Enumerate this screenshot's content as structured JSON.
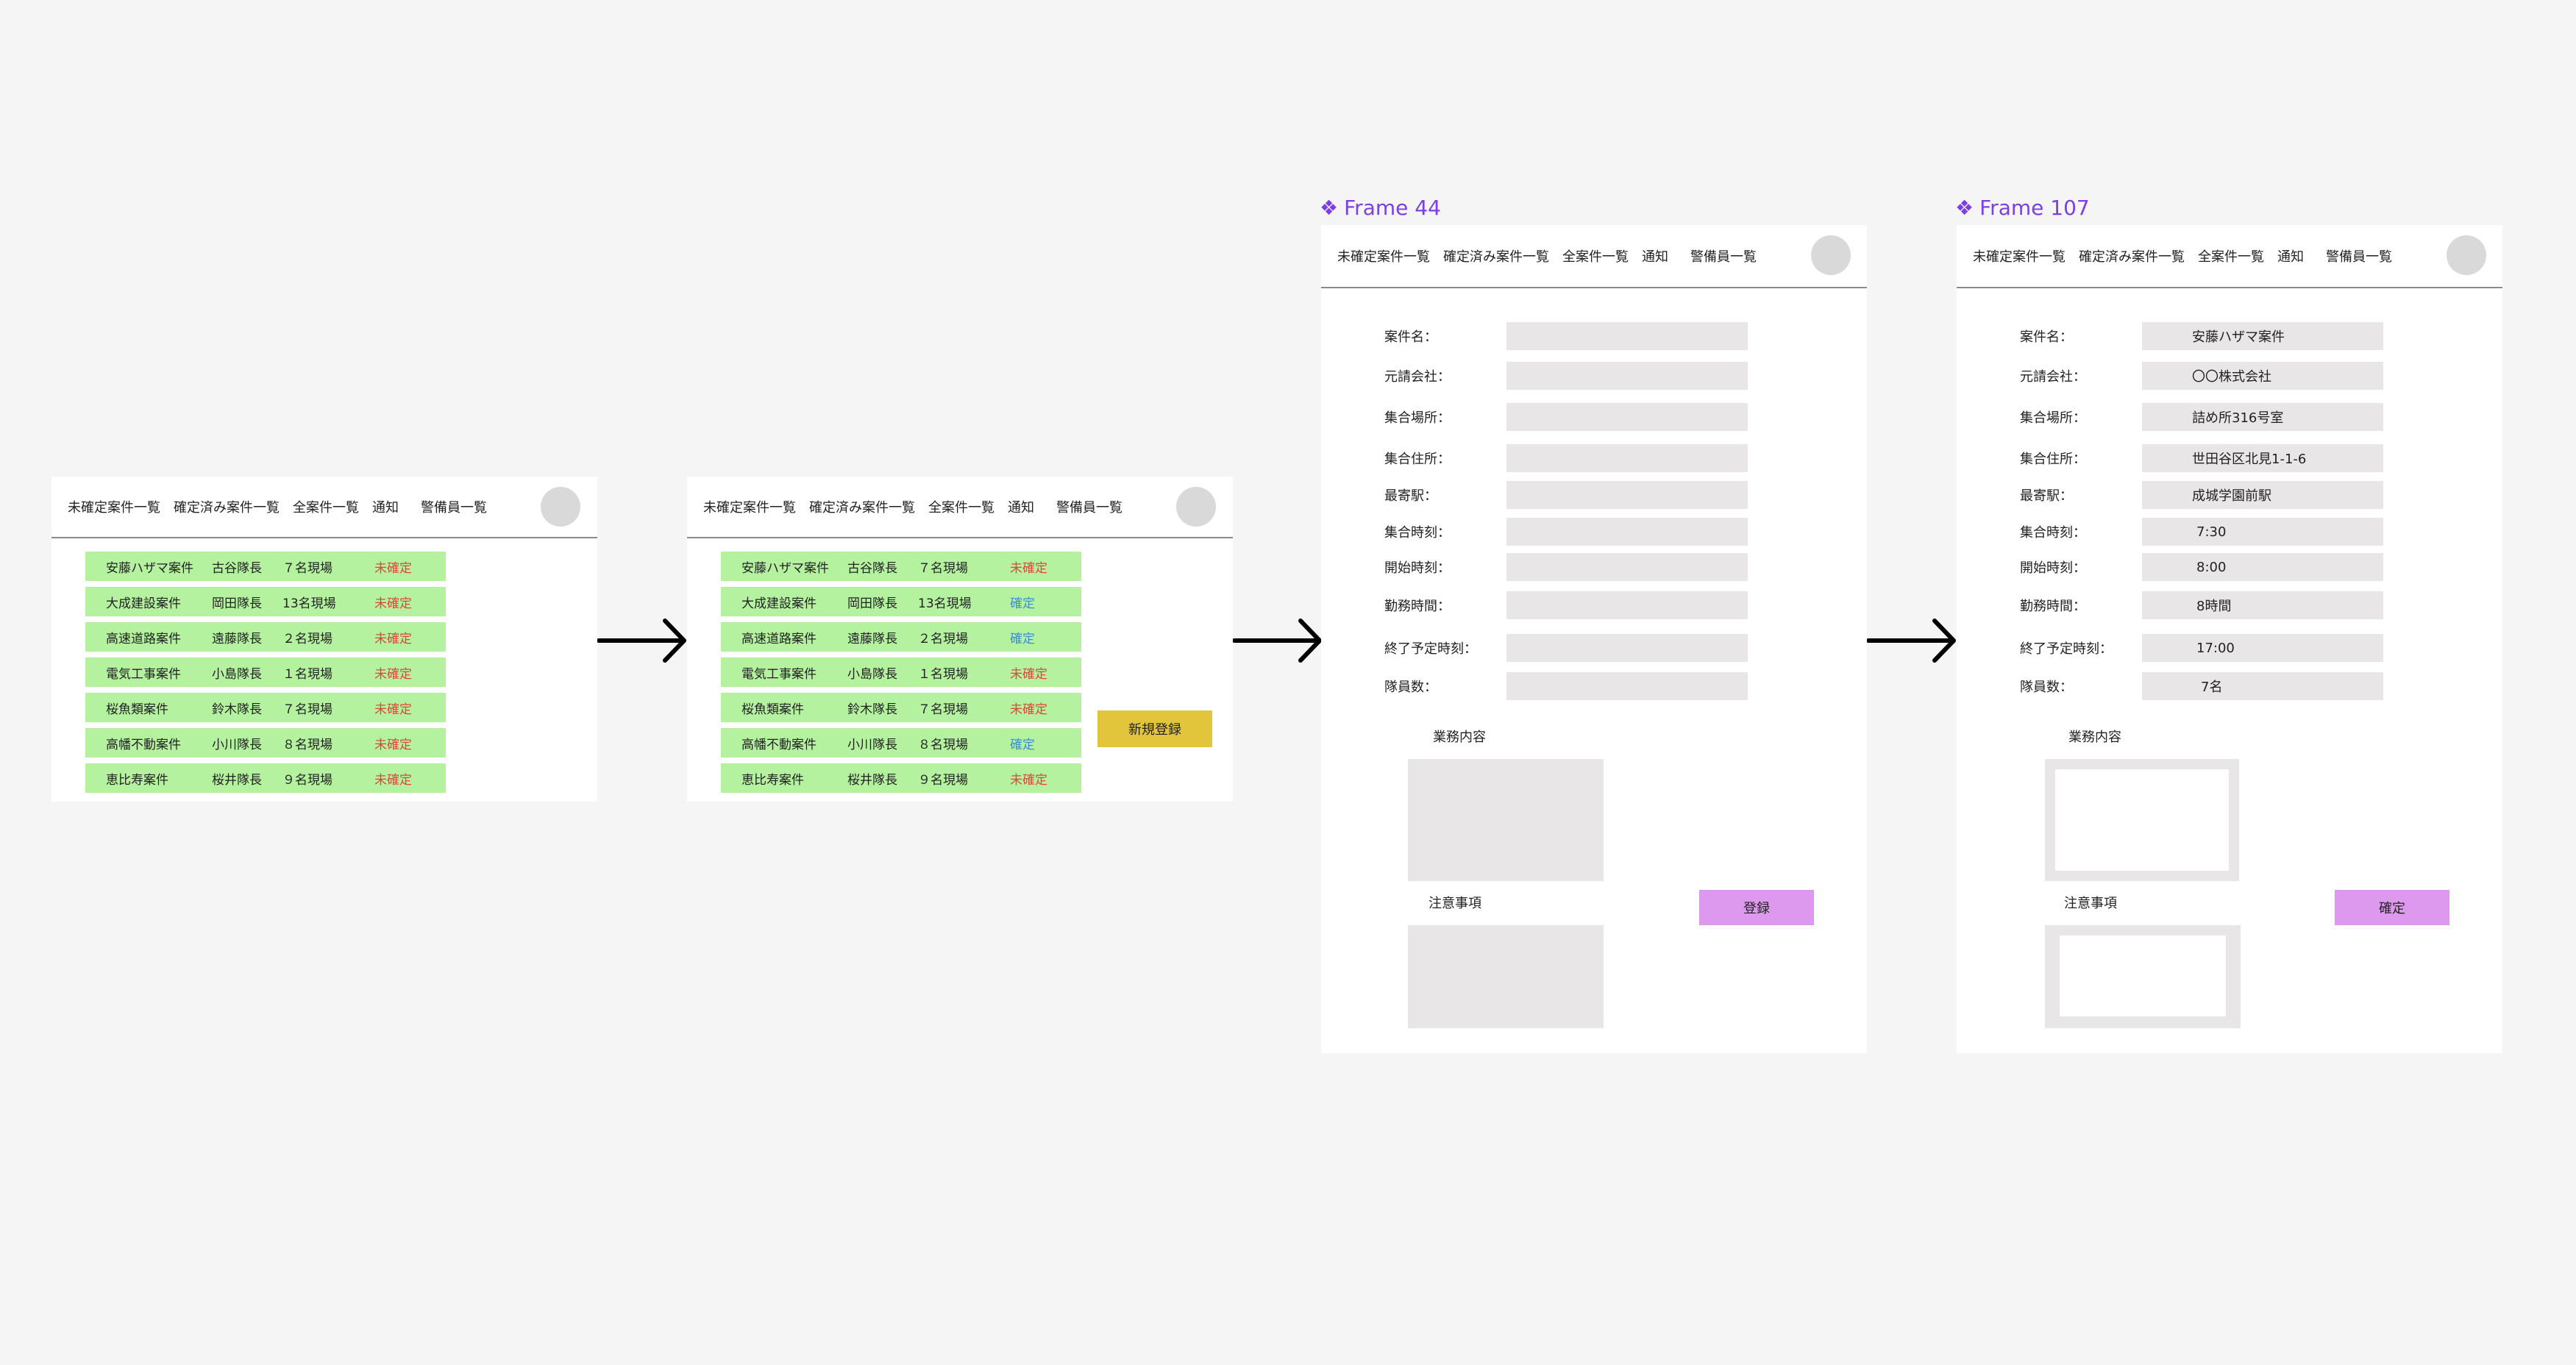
{
  "nav": {
    "unconfirmed": "未確定案件一覧",
    "confirmed": "確定済み案件一覧",
    "all": "全案件一覧",
    "notify": "通知",
    "guards": "警備員一覧"
  },
  "list1": [
    {
      "name": "安藤ハザマ案件",
      "leader": "古谷隊長",
      "count": "７名現場",
      "status": "未確定",
      "status_color": "#e0453a"
    },
    {
      "name": "大成建設案件",
      "leader": "岡田隊長",
      "count": "13名現場",
      "status": "未確定",
      "status_color": "#e0453a"
    },
    {
      "name": "高速道路案件",
      "leader": "遠藤隊長",
      "count": "２名現場",
      "status": "未確定",
      "status_color": "#e0453a"
    },
    {
      "name": "電気工事案件",
      "leader": "小島隊長",
      "count": "１名現場",
      "status": "未確定",
      "status_color": "#e0453a"
    },
    {
      "name": "桜魚類案件",
      "leader": "鈴木隊長",
      "count": "７名現場",
      "status": "未確定",
      "status_color": "#e0453a"
    },
    {
      "name": "高幡不動案件",
      "leader": "小川隊長",
      "count": "８名現場",
      "status": "未確定",
      "status_color": "#e0453a"
    },
    {
      "name": "恵比寿案件",
      "leader": "桜井隊長",
      "count": "９名現場",
      "status": "未確定",
      "status_color": "#e0453a"
    }
  ],
  "list2": [
    {
      "name": "安藤ハザマ案件",
      "leader": "古谷隊長",
      "count": "７名現場",
      "status": "未確定",
      "status_color": "#e0453a"
    },
    {
      "name": "大成建設案件",
      "leader": "岡田隊長",
      "count": "13名現場",
      "status": "確定",
      "status_color": "#3b8ed6"
    },
    {
      "name": "高速道路案件",
      "leader": "遠藤隊長",
      "count": "２名現場",
      "status": "確定",
      "status_color": "#3b8ed6"
    },
    {
      "name": "電気工事案件",
      "leader": "小島隊長",
      "count": "１名現場",
      "status": "未確定",
      "status_color": "#e0453a"
    },
    {
      "name": "桜魚類案件",
      "leader": "鈴木隊長",
      "count": "７名現場",
      "status": "未確定",
      "status_color": "#e0453a"
    },
    {
      "name": "高幡不動案件",
      "leader": "小川隊長",
      "count": "８名現場",
      "status": "確定",
      "status_color": "#3b8ed6"
    },
    {
      "name": "恵比寿案件",
      "leader": "桜井隊長",
      "count": "９名現場",
      "status": "未確定",
      "status_color": "#e0453a"
    }
  ],
  "new_register_label": "新規登録",
  "frame44_title": "Frame 44",
  "frame107_title": "Frame 107",
  "form": {
    "case_name": "案件名：",
    "contractor": "元請会社：",
    "meeting_place": "集合場所：",
    "meeting_address": "集合住所：",
    "nearest_station": "最寄駅：",
    "meeting_time": "集合時刻：",
    "start_time": "開始時刻：",
    "work_hours": "勤務時間：",
    "end_time": "終了予定時刻：",
    "member_count": "隊員数：",
    "work_content": "業務内容",
    "notes": "注意事項"
  },
  "register_label": "登録",
  "confirm_label": "確定",
  "values": {
    "case_name": "安藤ハザマ案件",
    "contractor": "〇〇株式会社",
    "meeting_place": "詰め所316号室",
    "meeting_address": "世田谷区北見1-1-6",
    "nearest_station": "成城学園前駅",
    "meeting_time": "7:30",
    "start_time": "8:00",
    "work_hours": "8時間",
    "end_time": "17:00",
    "member_count": "7名"
  },
  "colors": {
    "row_bg": "#b4f2a0",
    "unconfirmed": "#e0453a",
    "confirmed": "#3b8ed6",
    "new_register_btn": "#e3c53b",
    "purple_btn": "#dd99ee",
    "frame_title": "#7b3fe4"
  },
  "icons": {
    "component": "component-icon",
    "arrow": "arrow-right-icon",
    "avatar": "avatar"
  }
}
